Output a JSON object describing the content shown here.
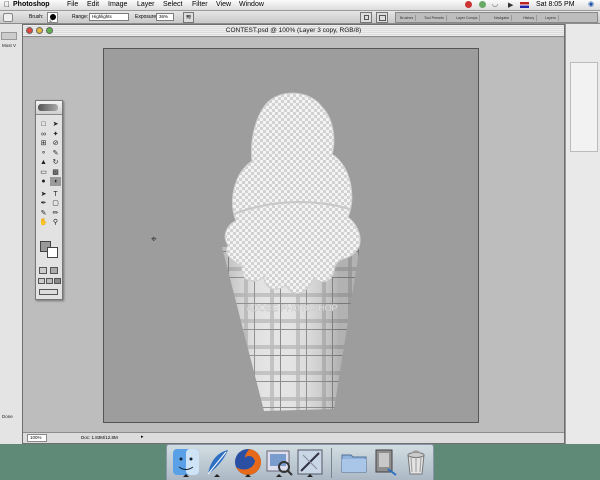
{
  "menubar": {
    "apple": "",
    "app": "Photoshop",
    "items": [
      "File",
      "Edit",
      "Image",
      "Layer",
      "Select",
      "Filter",
      "View",
      "Window"
    ],
    "clock": "Sat 8:05 PM"
  },
  "options": {
    "brush_label": "Brush:",
    "brush_size": "47",
    "range_label": "Range:",
    "range_value": "Highlights",
    "exposure_label": "Exposure:",
    "exposure_value": "36%",
    "palette_tabs": [
      "Brushes",
      "Tool Presets",
      "Layer Comps",
      "Navigator",
      "History",
      "Layers"
    ]
  },
  "document": {
    "title": "CONTEST.psd @ 100% (Layer 3 copy, RGB/8)",
    "zoom": "100%",
    "doc_size": "Doc: 1.83M/12.8M",
    "watermark_text": "ADOBE PHOTOSHOP"
  },
  "left_background": {
    "label": "Most V",
    "status": "Done"
  },
  "colors": {
    "desktop": "#5f8a78",
    "canvas": "#9d9d9d",
    "window_bg": "#bdbdbd"
  },
  "dock": {
    "icons": [
      "finder-icon",
      "feather-icon",
      "firefox-icon",
      "preview-icon",
      "photoshop-icon",
      "folder-icon",
      "document-icon",
      "trash-icon"
    ]
  }
}
